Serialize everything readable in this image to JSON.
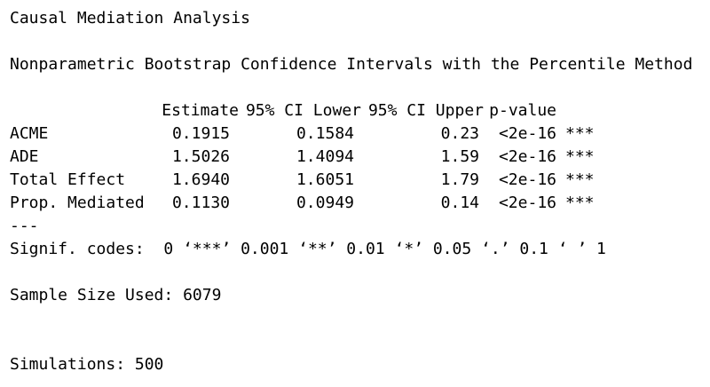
{
  "title": "Causal Mediation Analysis",
  "subtitle": "Nonparametric Bootstrap Confidence Intervals with the Percentile Method",
  "table": {
    "headers": [
      "Estimate",
      "95% CI Lower",
      "95% CI Upper",
      "p-value"
    ],
    "rows": [
      {
        "label": "ACME",
        "estimate": "0.1915",
        "ci_lower": "0.1584",
        "ci_upper": "0.23",
        "p_value": "<2e-16",
        "signif": "***"
      },
      {
        "label": "ADE",
        "estimate": "1.5026",
        "ci_lower": "1.4094",
        "ci_upper": "1.59",
        "p_value": "<2e-16",
        "signif": "***"
      },
      {
        "label": "Total Effect",
        "estimate": "1.6940",
        "ci_lower": "1.6051",
        "ci_upper": "1.79",
        "p_value": "<2e-16",
        "signif": "***"
      },
      {
        "label": "Prop. Mediated",
        "estimate": "0.1130",
        "ci_lower": "0.0949",
        "ci_upper": "0.14",
        "p_value": "<2e-16",
        "signif": "***"
      }
    ]
  },
  "separator": "---",
  "signif_codes": "Signif. codes:  0 ‘***’ 0.001 ‘**’ 0.01 ‘*’ 0.05 ‘.’ 0.1 ‘ ’ 1",
  "sample_size": "Sample Size Used: 6079",
  "simulations": "Simulations: 500"
}
